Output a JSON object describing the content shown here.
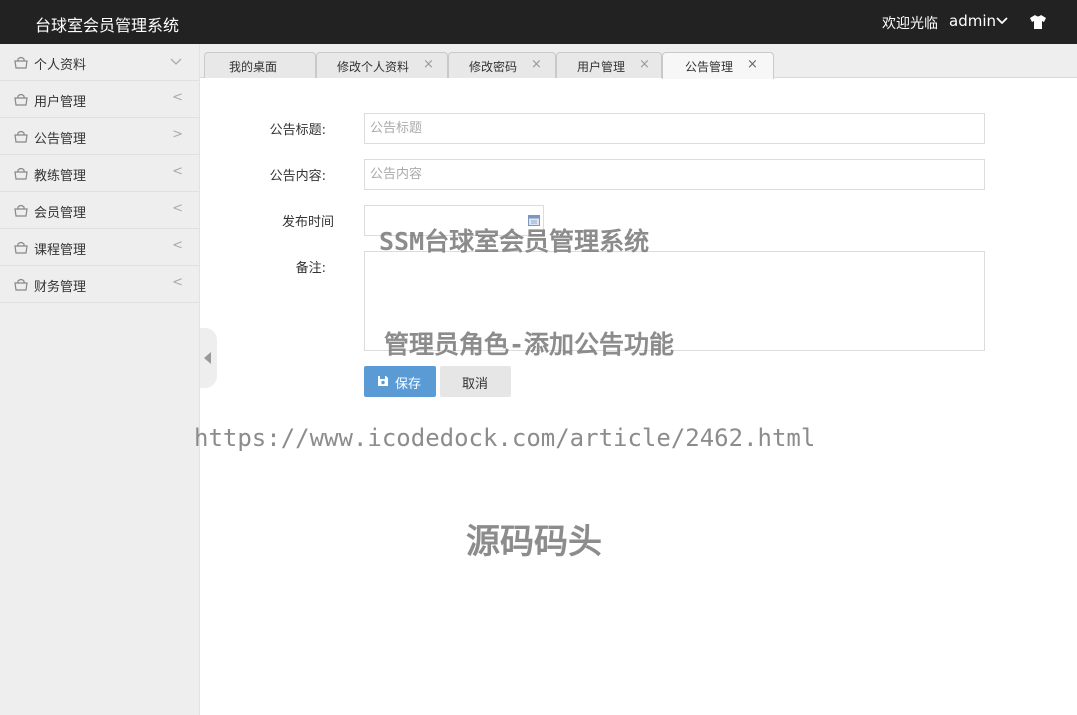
{
  "header": {
    "app_title": "台球室会员管理系统",
    "welcome": "欢迎光临",
    "username": "admin",
    "colors": {
      "bar": "#222222",
      "accent": "#5b9bd5"
    }
  },
  "sidebar": {
    "items": [
      {
        "label": "个人资料",
        "arrow": "expanded"
      },
      {
        "label": "用户管理",
        "arrow": "<"
      },
      {
        "label": "公告管理",
        "arrow": ">"
      },
      {
        "label": "教练管理",
        "arrow": "<"
      },
      {
        "label": "会员管理",
        "arrow": "<"
      },
      {
        "label": "课程管理",
        "arrow": "<"
      },
      {
        "label": "财务管理",
        "arrow": "<"
      }
    ]
  },
  "tabs": [
    {
      "label": "我的桌面",
      "closable": false,
      "active": false
    },
    {
      "label": "修改个人资料",
      "closable": true,
      "active": false
    },
    {
      "label": "修改密码",
      "closable": true,
      "active": false
    },
    {
      "label": "用户管理",
      "closable": true,
      "active": false
    },
    {
      "label": "公告管理",
      "closable": true,
      "active": true
    }
  ],
  "form": {
    "title_label": "公告标题:",
    "title_placeholder": "公告标题",
    "content_label": "公告内容:",
    "content_placeholder": "公告内容",
    "time_label": "发布时间",
    "time_value": "",
    "remark_label": "备注:",
    "remark_value": "",
    "save_label": "保存",
    "cancel_label": "取消"
  },
  "watermarks": {
    "system": "SSM台球室会员管理系统",
    "feature": "管理员角色-添加公告功能",
    "url": "https://www.icodedock.com/article/2462.html",
    "brand": "源码码头"
  }
}
